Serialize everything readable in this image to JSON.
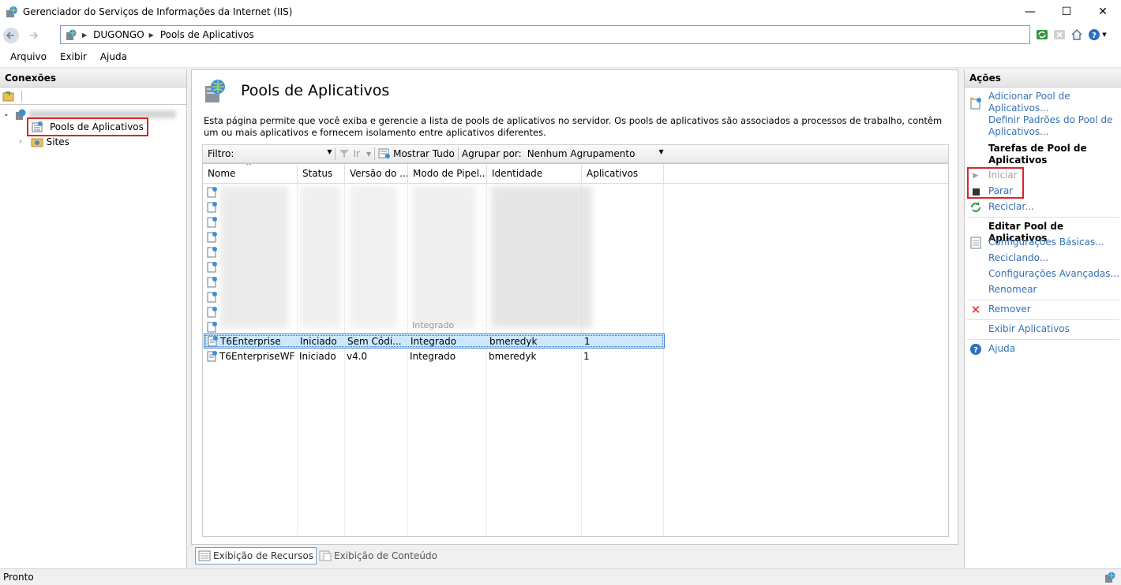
{
  "window": {
    "title": "Gerenciador do Serviços de Informações da Internet (IIS)",
    "minimize": "—",
    "maximize": "☐",
    "close": "✕"
  },
  "address": {
    "crumbs": [
      "DUGONGO",
      "Pools de Aplicativos"
    ]
  },
  "menu": {
    "items": [
      "Arquivo",
      "Exibir",
      "Ajuda"
    ]
  },
  "connections": {
    "header": "Conexões",
    "tree": {
      "pools_label": "Pools de Aplicativos",
      "sites_label": "Sites"
    }
  },
  "main": {
    "title": "Pools de Aplicativos",
    "description": "Esta página permite que você exiba e gerencie a lista de pools de aplicativos no servidor. Os pools de aplicativos são associados a processos de trabalho, contêm um ou mais aplicativos e fornecem isolamento entre aplicativos diferentes.",
    "filter": {
      "label": "Filtro:",
      "go": "Ir",
      "show_all": "Mostrar Tudo",
      "group_label": "Agrupar por:",
      "group_value": "Nenhum Agrupamento"
    },
    "columns": [
      "Nome",
      "Status",
      "Versão do ....",
      "Modo de Pipel...",
      "Identidade",
      "Aplicativos"
    ],
    "rows": [
      {
        "name": "T6Enterprise",
        "status": "Iniciado",
        "version": "Sem Códi...",
        "pipeline": "Integrado",
        "identity": "bmeredyk",
        "apps": "1"
      },
      {
        "name": "T6EnterpriseWF",
        "status": "Iniciado",
        "version": "v4.0",
        "pipeline": "Integrado",
        "identity": "bmeredyk",
        "apps": "1"
      }
    ],
    "partial_row": {
      "pipeline": "Integrado"
    },
    "view_tabs": [
      "Exibição de Recursos",
      "Exibição de Conteúdo"
    ]
  },
  "actions": {
    "header": "Ações",
    "add_pool": "Adicionar Pool de Aplicativos...",
    "set_defaults": "Definir Padrões do Pool de Aplicativos...",
    "tasks_heading": "Tarefas de Pool de Aplicativos",
    "start": "Iniciar",
    "stop": "Parar",
    "recycle": "Reciclar...",
    "edit_heading": "Editar Pool de Aplicativos",
    "basic_settings": "Configurações Básicas...",
    "recycling": "Reciclando...",
    "advanced_settings": "Configurações Avançadas...",
    "rename": "Renomear",
    "remove": "Remover",
    "view_apps": "Exibir Aplicativos",
    "help": "Ajuda"
  },
  "status": {
    "text": "Pronto"
  },
  "colors": {
    "link": "#3670b4",
    "highlight": "#d9252b",
    "selection": "#cce8ff"
  }
}
